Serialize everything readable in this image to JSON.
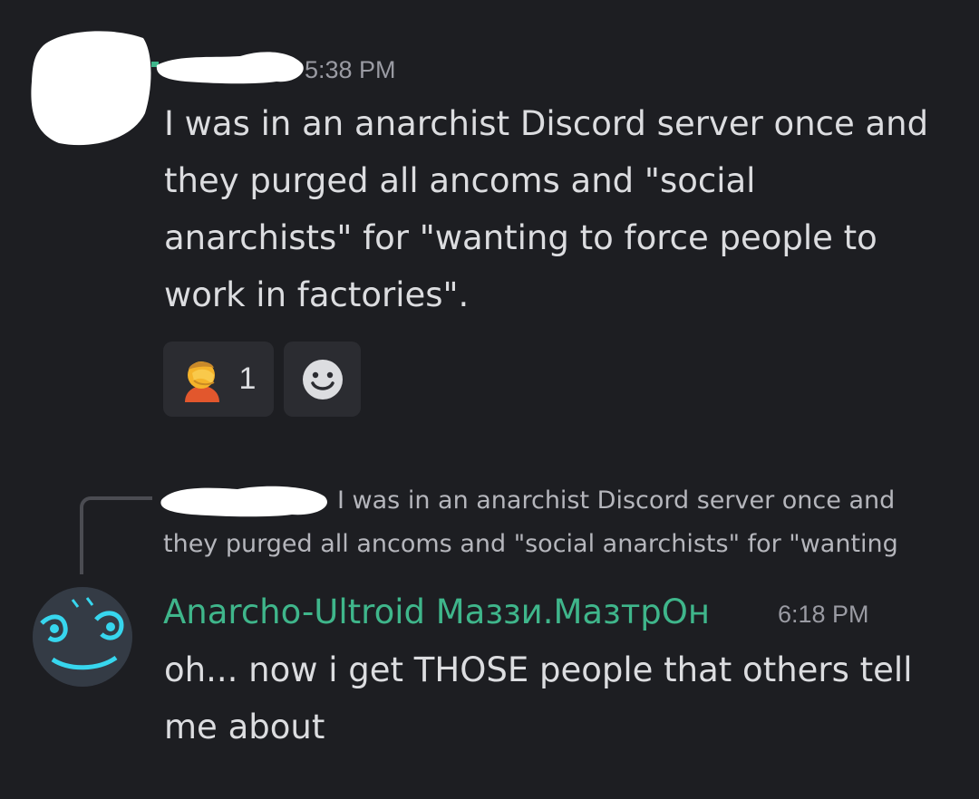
{
  "message1": {
    "timestamp": "5:38 PM",
    "lines": [
      "I was in an anarchist Discord server once and",
      "they purged all ancoms and \"social",
      "anarchists\" for \"wanting to force people to",
      "work in factories\"."
    ],
    "reactions": [
      {
        "icon": "facepalm-emoji-icon",
        "count": "1"
      },
      {
        "icon": "add-reaction-smiley-icon"
      }
    ]
  },
  "reply_reference": {
    "line1": "I was in an anarchist Discord server once and",
    "line2": "they purged all ancoms and \"social anarchists\" for \"wanting"
  },
  "message2": {
    "username": "Anarcho-Ultroid Маззи.МазтрОн",
    "timestamp": "6:18 PM",
    "lines": [
      "oh... now i get THOSE people that others tell",
      "me about"
    ],
    "username_color": "#3fb68b"
  },
  "colors": {
    "background": "#1d1e22",
    "text": "#dcdde0",
    "muted": "#9a9ba3",
    "reaction_bg": "#2b2c31"
  }
}
